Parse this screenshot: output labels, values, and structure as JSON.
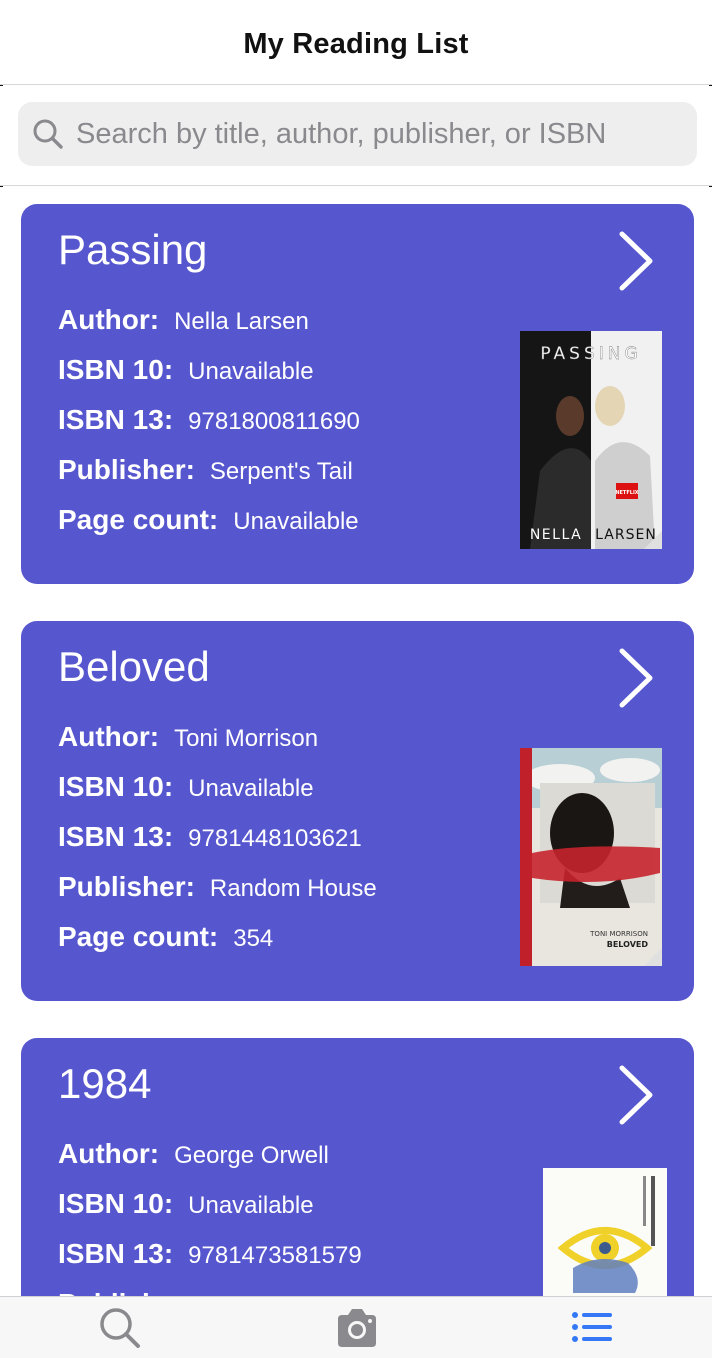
{
  "header": {
    "title": "My Reading List"
  },
  "search": {
    "placeholder": "Search by title, author, publisher, or ISBN",
    "value": ""
  },
  "labels": {
    "author": "Author:",
    "isbn10": "ISBN 10:",
    "isbn13": "ISBN 13:",
    "publisher": "Publisher:",
    "page_count": "Page count:"
  },
  "books": [
    {
      "title": "Passing",
      "author": "Nella Larsen",
      "isbn10": "Unavailable",
      "isbn13": "9781800811690",
      "publisher": "Serpent's Tail",
      "page_count": "Unavailable",
      "cover": {
        "top_text": "PASSING",
        "bottom_left": "NELLA",
        "bottom_right": "LARSEN",
        "badge": "NETFLIX"
      }
    },
    {
      "title": "Beloved",
      "author": "Toni Morrison",
      "isbn10": "Unavailable",
      "isbn13": "9781448103621",
      "publisher": "Random House",
      "page_count": "354",
      "cover": {
        "author_text": "TONI MORRISON",
        "title_text": "BELOVED"
      }
    },
    {
      "title": "1984",
      "author": "George Orwell",
      "isbn10": "Unavailable",
      "isbn13": "9781473581579",
      "publisher": "",
      "page_count": "",
      "cover": {}
    }
  ],
  "tabs": [
    {
      "icon": "search-icon",
      "active": false
    },
    {
      "icon": "camera-icon",
      "active": false
    },
    {
      "icon": "list-icon",
      "active": true
    }
  ],
  "colors": {
    "card": "#5656cf",
    "active_tab": "#3478f6",
    "inactive_tab": "#8a8a8e"
  }
}
